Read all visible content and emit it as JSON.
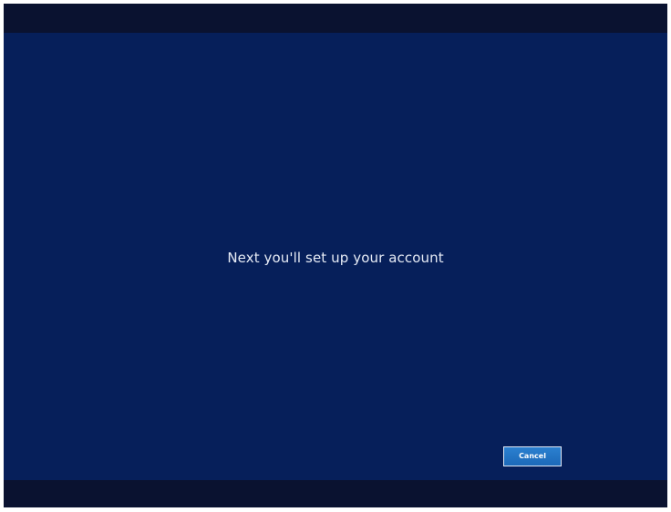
{
  "setup": {
    "message": "Next you'll set up your account",
    "cancel_label": "Cancel"
  },
  "colors": {
    "background": "#061f5a",
    "bars": "#0a1230",
    "button": "#1c69b8",
    "text": "#e6ebf5"
  }
}
